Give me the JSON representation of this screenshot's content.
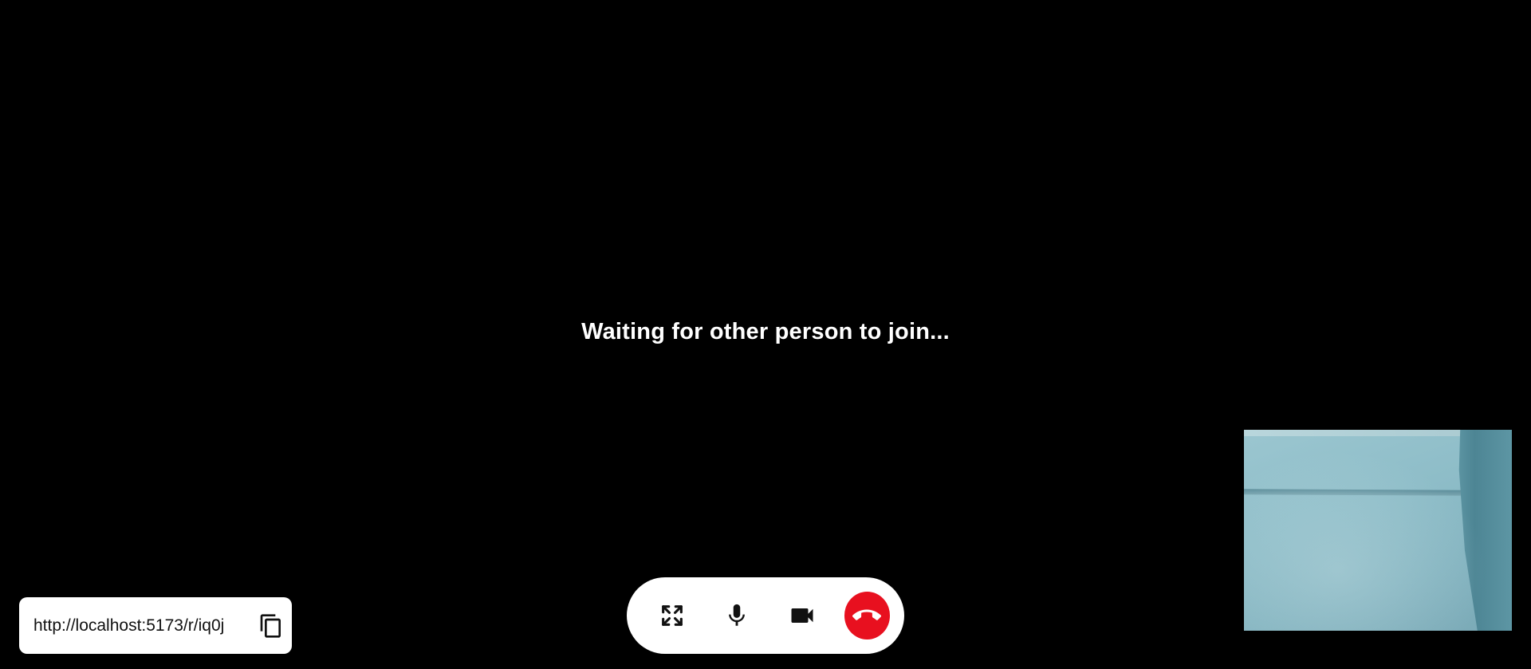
{
  "status": {
    "waiting_text": "Waiting for other person to join..."
  },
  "share": {
    "link_value": "http://localhost:5173/r/iq0j",
    "copy_icon": "copy-icon"
  },
  "controls": {
    "fullscreen_icon": "fullscreen-icon",
    "mic_icon": "microphone-icon",
    "camera_icon": "video-camera-icon",
    "end_call_icon": "hang-up-icon",
    "end_call_color": "#e8101f"
  },
  "colors": {
    "background": "#000000",
    "panel": "#ffffff",
    "text_primary": "#ffffff"
  }
}
